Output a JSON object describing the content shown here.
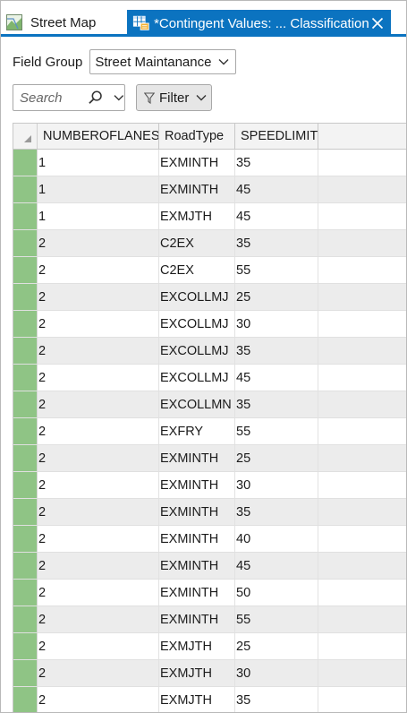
{
  "tabs": [
    {
      "label": "Street Map",
      "icon": "map-icon",
      "active": false
    },
    {
      "label": "*Contingent Values: ... Classification",
      "icon": "table-icon",
      "active": true
    }
  ],
  "field_group": {
    "label": "Field Group",
    "selected": "Street Maintanance"
  },
  "search": {
    "placeholder": "Search"
  },
  "filter": {
    "label": "Filter"
  },
  "table": {
    "columns": [
      "NUMBEROFLANES",
      "RoadType",
      "SPEEDLIMIT"
    ],
    "rows": [
      [
        "1",
        "EXMINTH",
        "35"
      ],
      [
        "1",
        "EXMINTH",
        "45"
      ],
      [
        "1",
        "EXMJTH",
        "45"
      ],
      [
        "2",
        "C2EX",
        "35"
      ],
      [
        "2",
        "C2EX",
        "55"
      ],
      [
        "2",
        "EXCOLLMJ",
        "25"
      ],
      [
        "2",
        "EXCOLLMJ",
        "30"
      ],
      [
        "2",
        "EXCOLLMJ",
        "35"
      ],
      [
        "2",
        "EXCOLLMJ",
        "45"
      ],
      [
        "2",
        "EXCOLLMN",
        "35"
      ],
      [
        "2",
        "EXFRY",
        "55"
      ],
      [
        "2",
        "EXMINTH",
        "25"
      ],
      [
        "2",
        "EXMINTH",
        "30"
      ],
      [
        "2",
        "EXMINTH",
        "35"
      ],
      [
        "2",
        "EXMINTH",
        "40"
      ],
      [
        "2",
        "EXMINTH",
        "45"
      ],
      [
        "2",
        "EXMINTH",
        "50"
      ],
      [
        "2",
        "EXMINTH",
        "55"
      ],
      [
        "2",
        "EXMJTH",
        "25"
      ],
      [
        "2",
        "EXMJTH",
        "30"
      ],
      [
        "2",
        "EXMJTH",
        "35"
      ]
    ]
  },
  "colors": {
    "accent": "#0b73c0",
    "row_marker": "#8fc485",
    "row_alt": "#ececec"
  }
}
